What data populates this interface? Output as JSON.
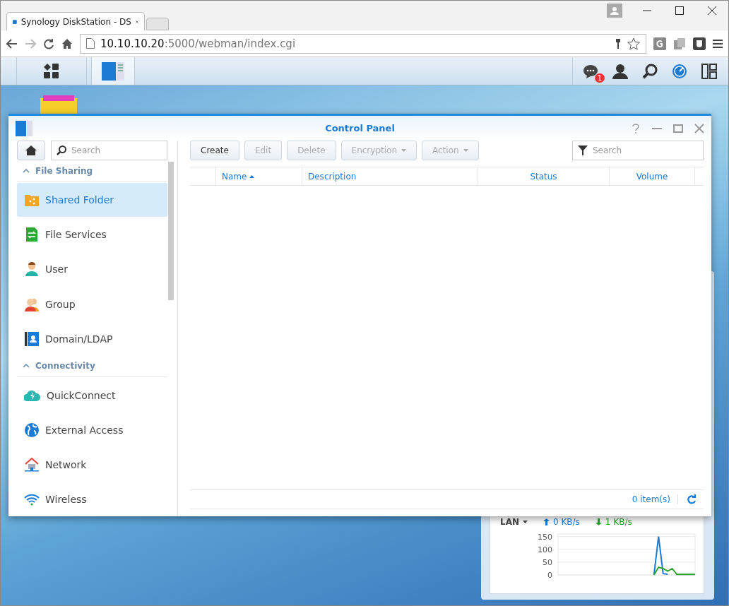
{
  "browser": {
    "tab_title": "Synology DiskStation - DS",
    "url_host": "10.10.10.20",
    "url_path": ":5000/webman/index.cgi"
  },
  "taskbar": {
    "notification_count": "1"
  },
  "widget": {
    "interface": "LAN",
    "upload": "0 KB/s",
    "download": "1 KB/s",
    "chart_data": {
      "type": "line",
      "grid": true,
      "ylim": [
        0,
        160
      ],
      "yticks": [
        0,
        50,
        100,
        150
      ],
      "series": [
        {
          "color": "#1a7ad4",
          "values": [
            null,
            null,
            null,
            null,
            null,
            null,
            null,
            null,
            null,
            null,
            null,
            null,
            null,
            null,
            null,
            null,
            null,
            null,
            null,
            null,
            null,
            0,
            150,
            5,
            3,
            null,
            null,
            null,
            null,
            null,
            null
          ]
        },
        {
          "color": "#2ca02c",
          "values": [
            null,
            null,
            null,
            null,
            null,
            null,
            null,
            null,
            null,
            null,
            null,
            null,
            null,
            null,
            null,
            null,
            null,
            null,
            null,
            null,
            null,
            0,
            30,
            25,
            15,
            25,
            2,
            2,
            2,
            2,
            2
          ]
        }
      ]
    }
  },
  "window": {
    "title": "Control Panel",
    "sidebar_search": {
      "placeholder": "Search"
    },
    "sections": [
      {
        "title": "File Sharing",
        "expanded": true,
        "items": [
          {
            "label": "Shared Folder",
            "kind": "folder",
            "selected": true
          },
          {
            "label": "File Services",
            "kind": "services",
            "selected": false
          },
          {
            "label": "User",
            "kind": "user",
            "selected": false
          },
          {
            "label": "Group",
            "kind": "group",
            "selected": false
          },
          {
            "label": "Domain/LDAP",
            "kind": "domain",
            "selected": false
          }
        ]
      },
      {
        "title": "Connectivity",
        "expanded": true,
        "items": [
          {
            "label": "QuickConnect",
            "kind": "cloud",
            "selected": false
          },
          {
            "label": "External Access",
            "kind": "globe",
            "selected": false
          },
          {
            "label": "Network",
            "kind": "network",
            "selected": false
          },
          {
            "label": "Wireless",
            "kind": "wifi",
            "selected": false
          }
        ]
      }
    ],
    "toolbar": [
      {
        "label": "Create",
        "disabled": false,
        "dropdown": false
      },
      {
        "label": "Edit",
        "disabled": true,
        "dropdown": false
      },
      {
        "label": "Delete",
        "disabled": true,
        "dropdown": false
      },
      {
        "label": "Encryption",
        "disabled": true,
        "dropdown": true
      },
      {
        "label": "Action",
        "disabled": true,
        "dropdown": true
      }
    ],
    "filter": {
      "placeholder": "Search"
    },
    "columns": [
      {
        "label": "Name",
        "sorted": true
      },
      {
        "label": "Description",
        "sorted": false
      },
      {
        "label": "Status",
        "sorted": false
      },
      {
        "label": "Volume",
        "sorted": false
      }
    ],
    "item_count": "0 item(s)"
  }
}
